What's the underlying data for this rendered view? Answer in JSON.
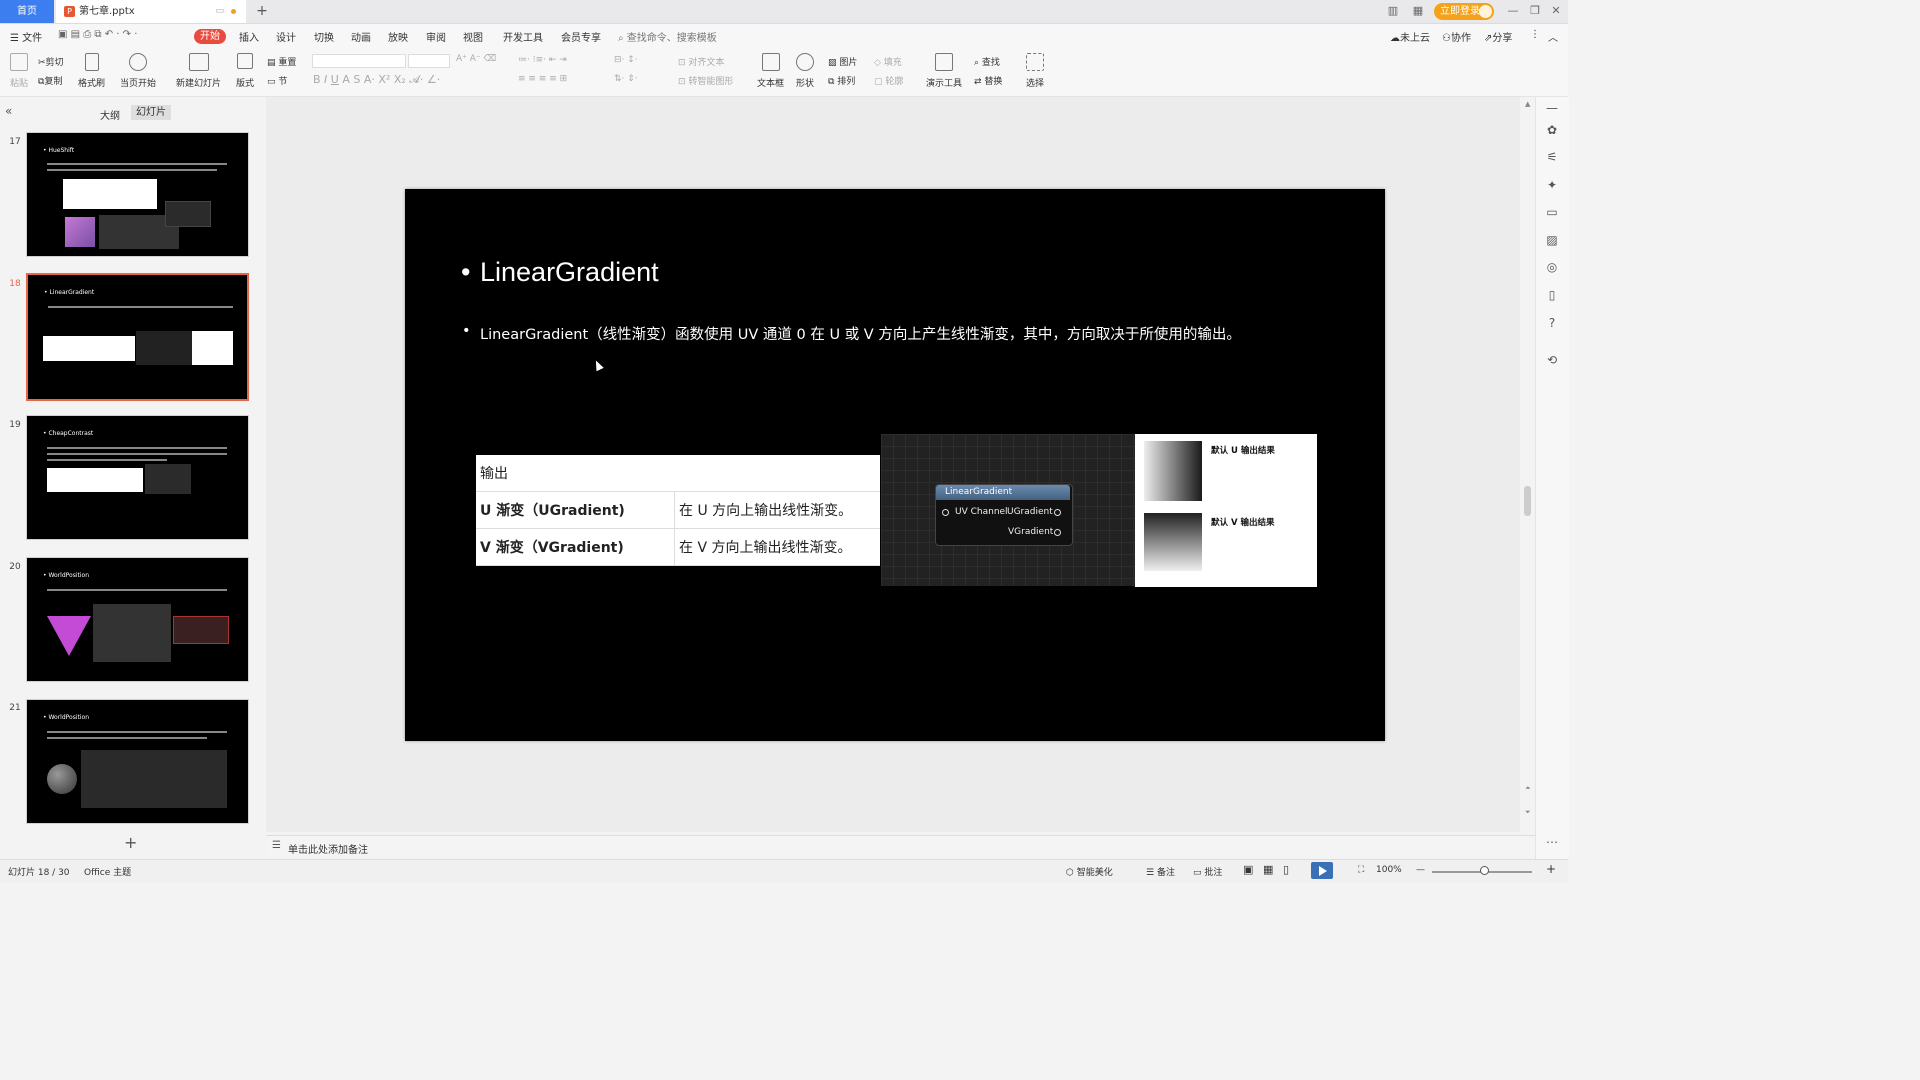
{
  "titlebar": {
    "home_tab": "首页",
    "doc_tab": "第七章.pptx",
    "login": "立即登录"
  },
  "menu": {
    "file": "文件",
    "items": [
      "开始",
      "插入",
      "设计",
      "切换",
      "动画",
      "放映",
      "审阅",
      "视图",
      "开发工具",
      "会员专享"
    ],
    "search_placeholder": "查找命令、搜索模板",
    "right": [
      "未上云",
      "协作",
      "分享"
    ]
  },
  "ribbon": {
    "paste": "粘贴",
    "cut": "剪切",
    "copy": "复制",
    "format_painter": "格式刷",
    "from_current": "当页开始",
    "new_slide": "新建幻灯片",
    "layout": "版式",
    "reset": "重置",
    "section": "节",
    "align_text": "对齐文本",
    "convert_smartart": "转智能图形",
    "textbox": "文本框",
    "shape": "形状",
    "picture": "图片",
    "fill": "填充",
    "arrange": "排列",
    "outline": "轮廓",
    "present_tools": "演示工具",
    "find": "查找",
    "replace": "替换",
    "select": "选择"
  },
  "panel": {
    "outline_tab": "大纲",
    "slides_tab": "幻灯片",
    "thumbnails": [
      {
        "num": "17",
        "title": "• HueShift",
        "selected": false
      },
      {
        "num": "18",
        "title": "• LinearGradient",
        "selected": true
      },
      {
        "num": "19",
        "title": "• CheapContrast",
        "selected": false
      },
      {
        "num": "20",
        "title": "• WorldPosition",
        "selected": false
      },
      {
        "num": "21",
        "title": "• WorldPosition",
        "selected": false
      }
    ],
    "add": "+"
  },
  "slide": {
    "title": "LinearGradient",
    "body": "LinearGradient（线性渐变）函数使用 UV 通道 0 在 U 或 V 方向上产生线性渐变，其中，方向取决于所使用的输出。",
    "table": {
      "header": "输出",
      "rows": [
        {
          "name": "U 渐变（UGradient)",
          "desc": "在 U 方向上输出线性渐变。"
        },
        {
          "name": "V 渐变（VGradient)",
          "desc": "在 V 方向上输出线性渐变。"
        }
      ]
    },
    "node": {
      "title": "LinearGradient",
      "input": "UV Channel",
      "out_u": "UGradient",
      "out_v": "VGradient"
    },
    "results": {
      "u": "默认 U 输出结果",
      "v": "默认 V 输出结果"
    }
  },
  "notes": {
    "placeholder": "单击此处添加备注"
  },
  "status": {
    "slide_info": "幻灯片 18 / 30",
    "theme": "Office 主题",
    "beautify": "智能美化",
    "notes": "备注",
    "comments": "批注",
    "zoom": "100%"
  }
}
